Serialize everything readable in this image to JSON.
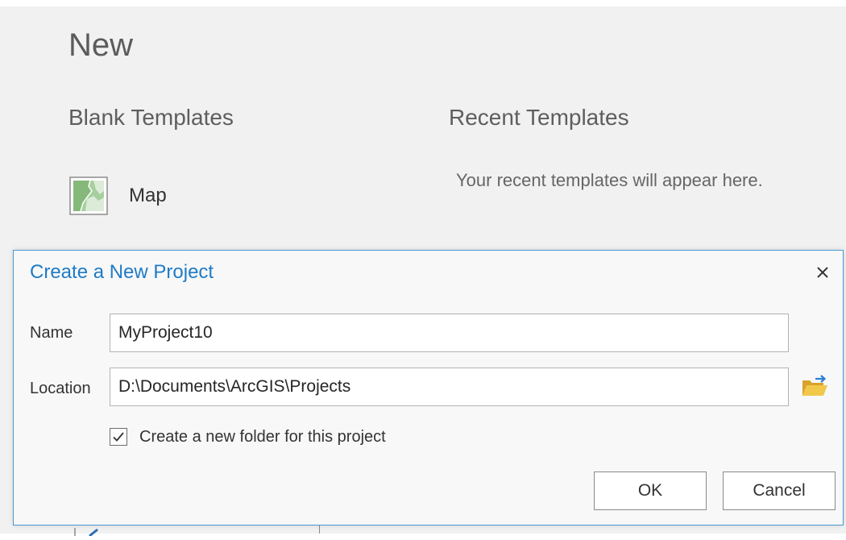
{
  "backstage": {
    "title": "New",
    "blank_templates": {
      "heading": "Blank Templates",
      "items": [
        {
          "label": "Map",
          "icon": "map-template-icon"
        }
      ]
    },
    "recent_templates": {
      "heading": "Recent Templates",
      "empty_message": "Your recent templates will appear here."
    }
  },
  "dialog": {
    "title": "Create a New Project",
    "close_icon": "close-icon",
    "name_label": "Name",
    "name_value": "MyProject10",
    "location_label": "Location",
    "location_value": "D:\\Documents\\ArcGIS\\Projects",
    "browse_icon": "folder-open-icon",
    "create_folder_label": "Create a new folder for this project",
    "create_folder_checked": true,
    "ok_label": "OK",
    "cancel_label": "Cancel"
  },
  "colors": {
    "accent": "#1e7bc6",
    "dialog_border": "#4b97d3",
    "backstage_bg": "#f1f1f1",
    "folder": "#e8b83a"
  }
}
